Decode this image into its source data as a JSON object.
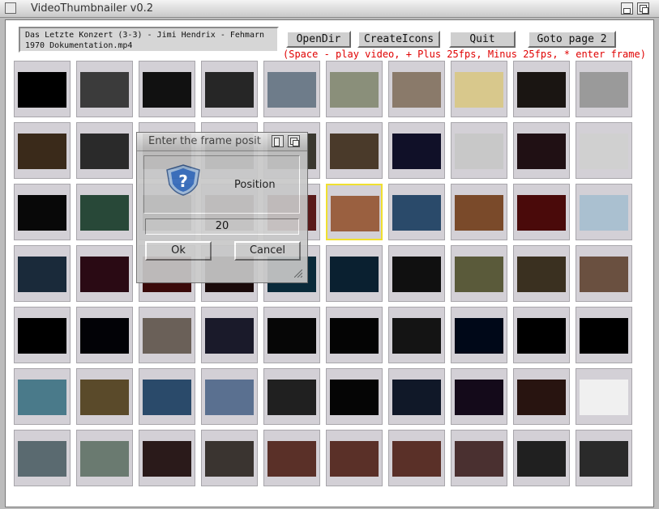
{
  "window": {
    "title": "VideoThumbnailer v0.2"
  },
  "file": {
    "name": "Das Letzte Konzert (3-3) - Jimi Hendrix - Fehmarn 1970 Dokumentation.mp4"
  },
  "toolbar": {
    "opendir_label": "OpenDir",
    "createicons_label": "CreateIcons",
    "quit_label": "Quit",
    "goto_label": "Goto page 2"
  },
  "hint": "(Space - play video, + Plus 25fps, Minus 25fps, * enter frame)",
  "dialog": {
    "title": "Enter the frame positi",
    "label": "Position",
    "value": "20",
    "ok_label": "Ok",
    "cancel_label": "Cancel"
  },
  "thumbnails": {
    "selected_index": 25,
    "frame_colors": [
      "#000000",
      "#3b3b3b",
      "#111111",
      "#262626",
      "#6e7c8a",
      "#8a8f7a",
      "#8a7a6a",
      "#d8c88c",
      "#1a1512",
      "#9a9a9a",
      "#3a2a1a",
      "#2a2a2a",
      "#2a1f1a",
      "#3a3a3a",
      "#3a3830",
      "#4a3a2a",
      "#101028",
      "#c8c8c8",
      "#201014",
      "#d0d0d0",
      "#080808",
      "#284838",
      "#3a3a3a",
      "#4a3a3a",
      "#5a1a1a",
      "#9a6040",
      "#2a4a6a",
      "#7a4a2a",
      "#4a0a0a",
      "#aac0d0",
      "#1a2a3a",
      "#2a0a14",
      "#3a0a0a",
      "#1a0a0a",
      "#0a2a3a",
      "#0a2030",
      "#101010",
      "#5a5a3a",
      "#3a3020",
      "#6a5040",
      "#000000",
      "#020206",
      "#6a6058",
      "#1a1a2a",
      "#060606",
      "#040404",
      "#141414",
      "#000818",
      "#000000",
      "#000000",
      "#4a7a8a",
      "#5a4a2a",
      "#2a4a6a",
      "#5a7090",
      "#202020",
      "#050505",
      "#101828",
      "#140a1a",
      "#281410",
      "#f0f0f0",
      "#5a6a70",
      "#6a7a70",
      "#2a1a1a",
      "#3a3430",
      "#5a3028",
      "#5a3028",
      "#5a3028",
      "#4a3030",
      "#202020",
      "#2a2a2a"
    ]
  }
}
